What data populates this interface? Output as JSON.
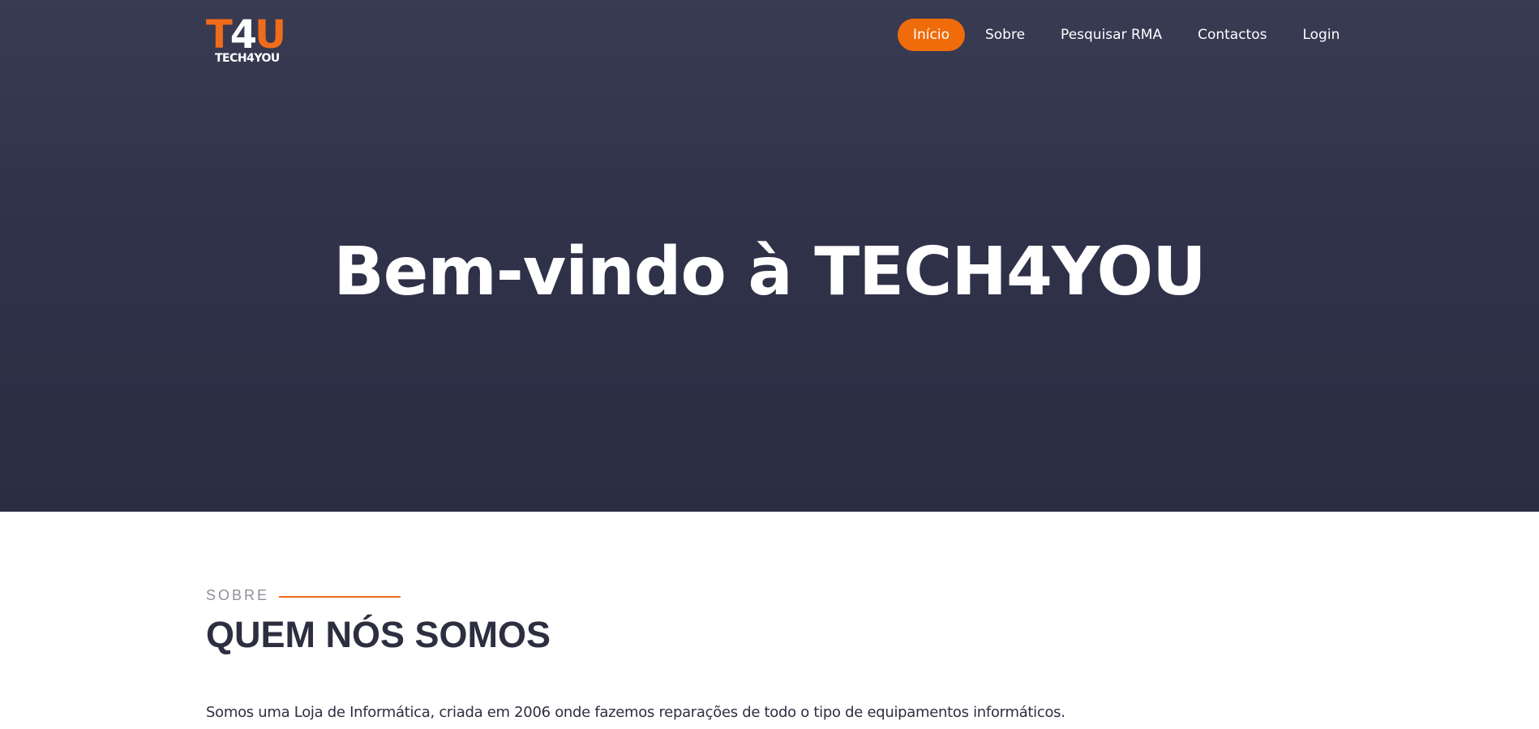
{
  "brand": {
    "mark_part1": "T",
    "mark_part2": "4",
    "mark_part3": "U",
    "name": "TECH4YOU",
    "colors": {
      "accent": "#f06b1b",
      "nav_active": "#f06b0a",
      "hero_bg": "#30324a",
      "heading": "#2d2f40"
    }
  },
  "nav": {
    "items": [
      {
        "label": "Início",
        "active": true
      },
      {
        "label": "Sobre",
        "active": false
      },
      {
        "label": "Pesquisar RMA",
        "active": false
      },
      {
        "label": "Contactos",
        "active": false
      },
      {
        "label": "Login",
        "active": false
      }
    ]
  },
  "hero": {
    "title": "Bem-vindo à TECH4YOU"
  },
  "about": {
    "eyebrow": "SOBRE",
    "title": "QUEM NÓS SOMOS",
    "text": "Somos uma Loja de Informática, criada em 2006 onde fazemos reparações de todo o tipo de equipamentos informáticos."
  }
}
